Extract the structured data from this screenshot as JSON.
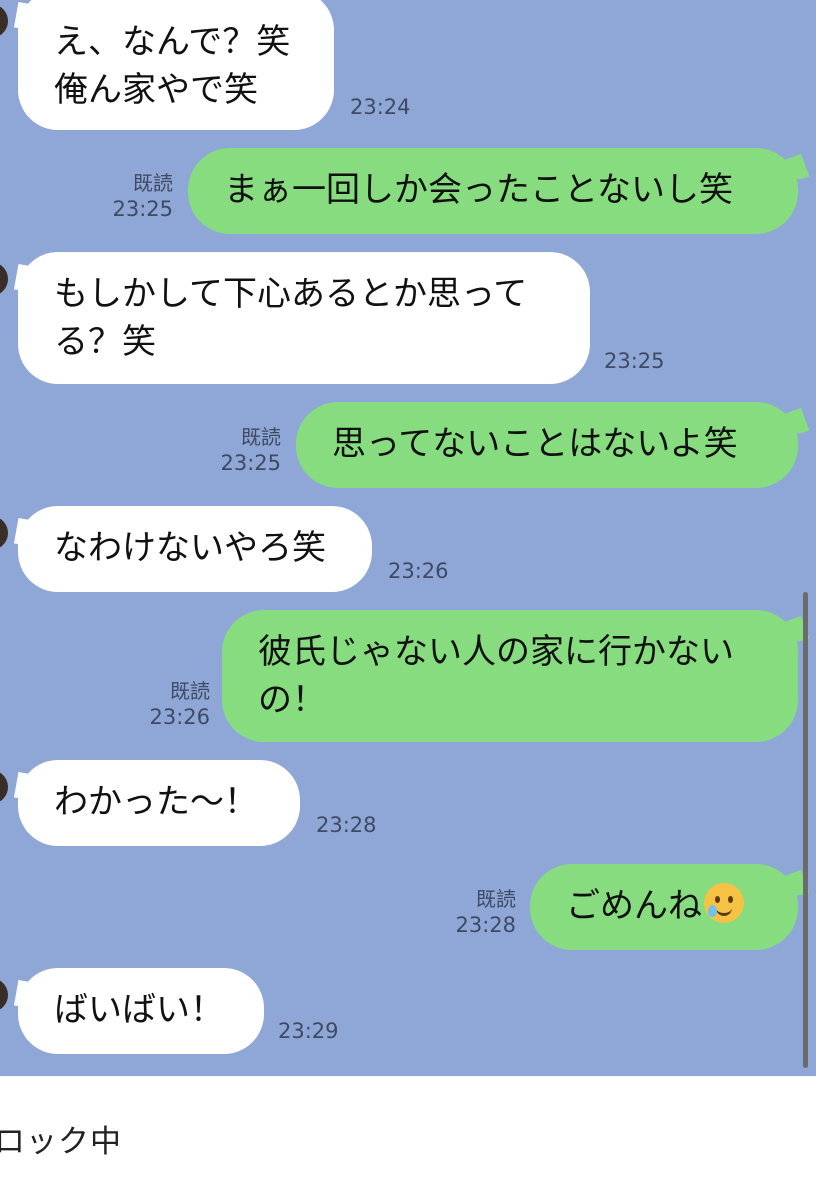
{
  "messages": [
    {
      "side": "in",
      "lines": [
        "え、なんで？笑",
        "俺ん家やで笑"
      ],
      "time": "23:24"
    },
    {
      "side": "out",
      "lines": [
        "まぁ一回しか会ったことないし笑"
      ],
      "read": "既読",
      "time": "23:25"
    },
    {
      "side": "in",
      "lines": [
        "もしかして下心あるとか思って",
        "る？笑"
      ],
      "time": "23:25"
    },
    {
      "side": "out",
      "lines": [
        "思ってないことはないよ笑"
      ],
      "read": "既読",
      "time": "23:25"
    },
    {
      "side": "in",
      "lines": [
        "なわけないやろ笑"
      ],
      "time": "23:26"
    },
    {
      "side": "out",
      "lines": [
        "彼氏じゃない人の家に行かない",
        "の！"
      ],
      "read": "既読",
      "time": "23:26"
    },
    {
      "side": "in",
      "lines": [
        "わかった〜！"
      ],
      "time": "23:28"
    },
    {
      "side": "out",
      "lines": [
        "ごめんね"
      ],
      "emoji": "smiling-face-with-tear-icon",
      "read": "既読",
      "time": "23:28"
    },
    {
      "side": "in",
      "lines": [
        "ばいばい！"
      ],
      "time": "23:29"
    }
  ],
  "footer": {
    "text": "ロック中"
  },
  "colors": {
    "chat_background": "#8fa7d6",
    "incoming_bubble": "#ffffff",
    "outgoing_bubble": "#86dc7e",
    "footer_background": "#ffffff"
  }
}
